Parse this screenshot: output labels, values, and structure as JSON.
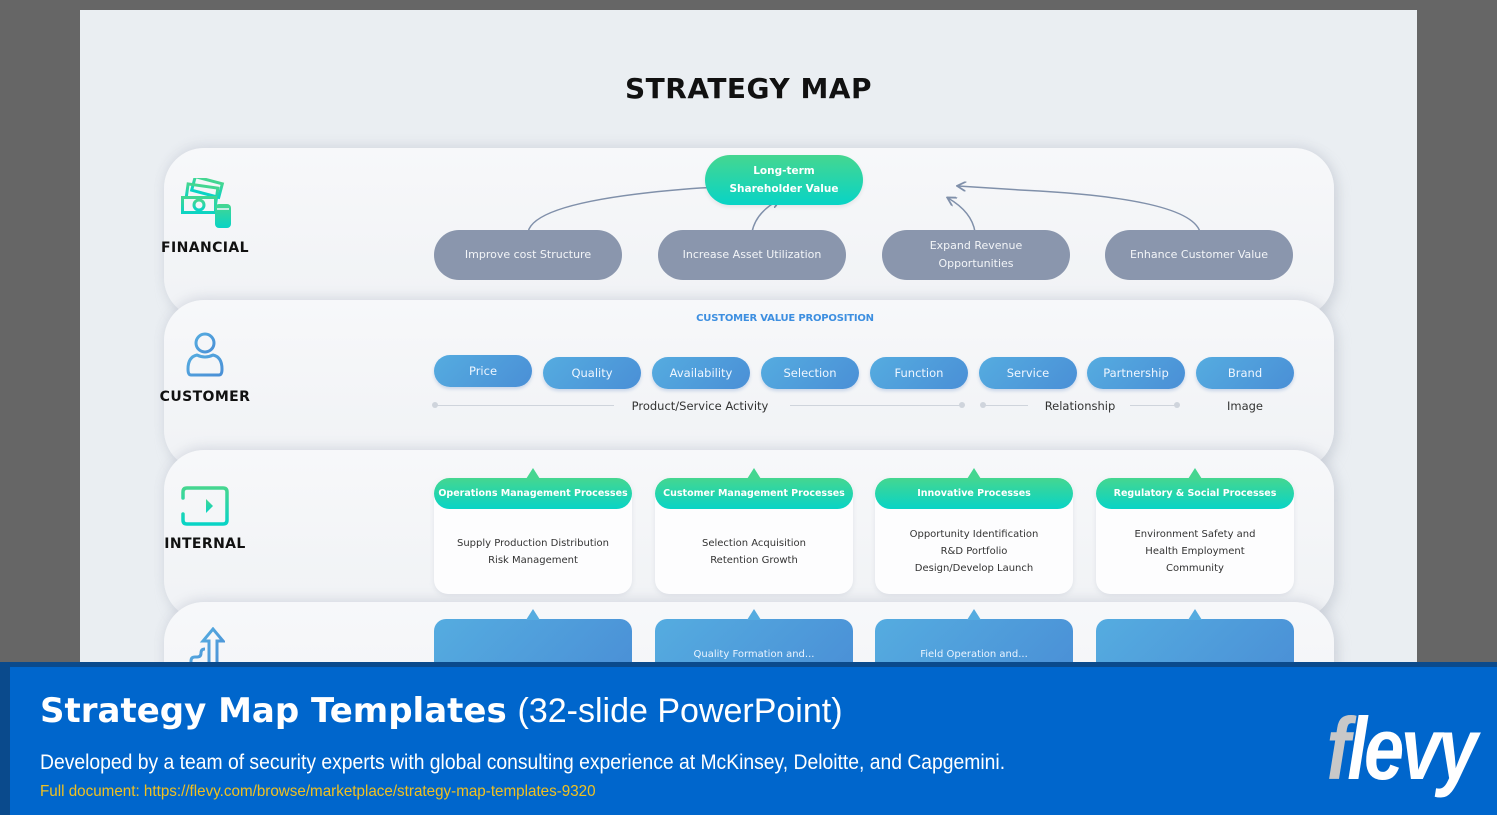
{
  "slide": {
    "title": "STRATEGY MAP",
    "perspectives": [
      {
        "key": "financial",
        "label": "FINANCIAL",
        "icon": "money-icon"
      },
      {
        "key": "customer",
        "label": "CUSTOMER",
        "icon": "user-icon"
      },
      {
        "key": "internal",
        "label": "INTERNAL",
        "icon": "sign-in-icon"
      },
      {
        "key": "learning",
        "label": "",
        "icon": "growth-arrow-icon"
      }
    ],
    "financial": {
      "goal": {
        "line1": "Long-term",
        "line2": "Shareholder Value"
      },
      "drivers": [
        {
          "line1": "Improve cost Structure",
          "line2": ""
        },
        {
          "line1": "Increase Asset Utilization",
          "line2": ""
        },
        {
          "line1": "Expand Revenue",
          "line2": "Opportunities"
        },
        {
          "line1": "Enhance Customer Value",
          "line2": ""
        }
      ]
    },
    "customer": {
      "value_proposition_title": "CUSTOMER VALUE PROPOSITION",
      "attributes": [
        "Price",
        "Quality",
        "Availability",
        "Selection",
        "Function",
        "Service",
        "Partnership",
        "Brand"
      ],
      "groups": [
        "Product/Service Activity",
        "Relationship",
        "Image"
      ]
    },
    "internal": {
      "processes": [
        {
          "title": "Operations Management Processes",
          "lines": [
            "Supply Production Distribution",
            "Risk Management"
          ]
        },
        {
          "title": "Customer Management Processes",
          "lines": [
            "Selection Acquisition",
            "Retention Growth"
          ]
        },
        {
          "title": "Innovative Processes",
          "lines": [
            "Opportunity Identification",
            "R&D Portfolio",
            "Design/Develop Launch"
          ]
        },
        {
          "title": "Regulatory & Social Processes",
          "lines": [
            "Environment Safety and",
            "Health Employment",
            "Community"
          ]
        }
      ]
    },
    "learning": {
      "cards": [
        "",
        "Quality Formation and...",
        "Field Operation and...",
        ""
      ]
    },
    "colors": {
      "green_start": "#45d690",
      "green_end": "#08d4c6",
      "blue_start": "#55ace0",
      "blue_end": "#4a8fd6",
      "grey_pill": "#8a96ad",
      "cvp_title": "#3d8fe0"
    }
  },
  "banner": {
    "title_bold": "Strategy Map Templates",
    "title_light": "(32-slide PowerPoint)",
    "subtitle": "Developed by a team of security experts with global consulting experience at McKinsey, Deloitte, and Capgemini.",
    "link_text": "Full document: https://flevy.com/browse/marketplace/strategy-map-templates-9320",
    "logo_f": "f",
    "logo_rest": "levy"
  }
}
